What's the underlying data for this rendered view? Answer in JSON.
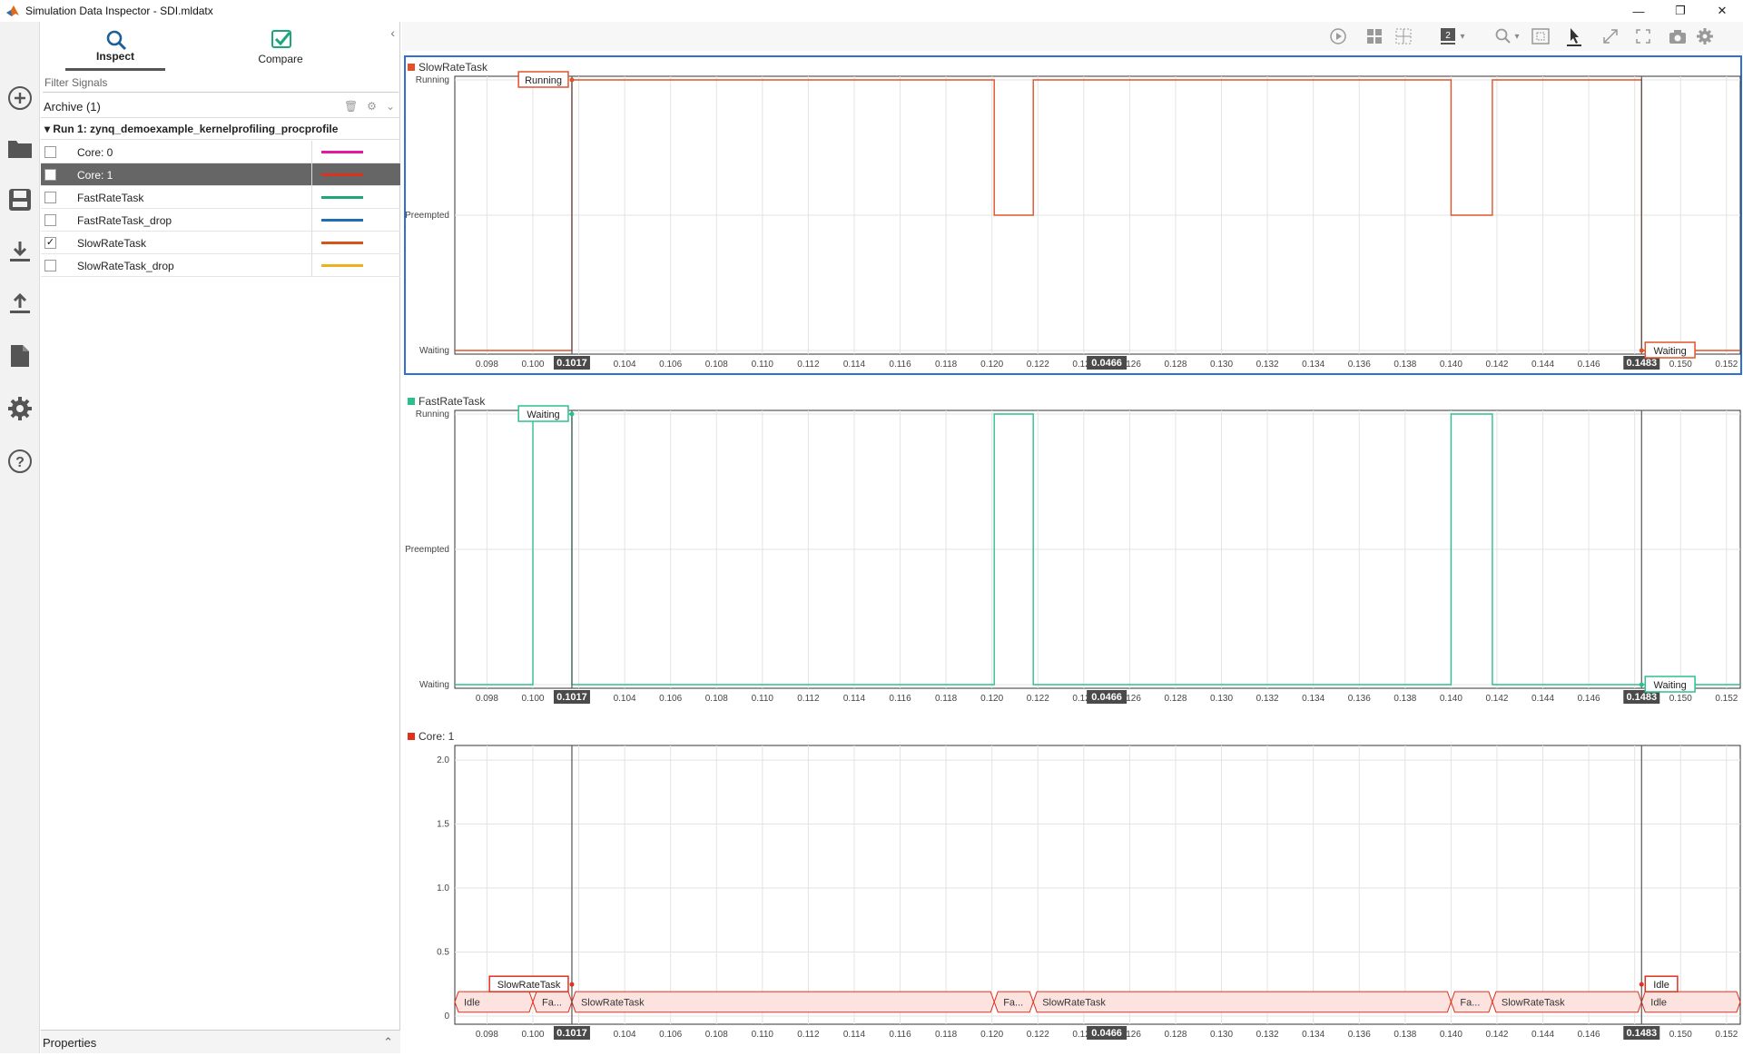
{
  "window": {
    "title": "Simulation Data Inspector - SDI.mldatx",
    "minimize": "—",
    "restore": "❐",
    "close": "✕"
  },
  "tabs": {
    "inspect": "Inspect",
    "compare": "Compare"
  },
  "filter": {
    "placeholder": "Filter Signals"
  },
  "archive": {
    "label": "Archive (1)"
  },
  "run": {
    "label": "Run 1: zynq_demoexample_kernelprofiling_procprofile"
  },
  "signals": [
    {
      "name": "Core: 0",
      "checked": false,
      "selected": false,
      "color": "#e5179f"
    },
    {
      "name": "Core: 1",
      "checked": false,
      "selected": true,
      "color": "#e0301e"
    },
    {
      "name": "FastRateTask",
      "checked": false,
      "selected": false,
      "color": "#1ea67a"
    },
    {
      "name": "FastRateTask_drop",
      "checked": false,
      "selected": false,
      "color": "#1f6eb5"
    },
    {
      "name": "SlowRateTask",
      "checked": true,
      "selected": false,
      "color": "#d95319"
    },
    {
      "name": "SlowRateTask_drop",
      "checked": false,
      "selected": false,
      "color": "#edb120"
    }
  ],
  "properties": {
    "label": "Properties"
  },
  "cursors": {
    "left": "0.1017",
    "right": "0.1483",
    "delta": "0.0466"
  },
  "x_ticks": [
    "0.098",
    "0.100",
    "0.102",
    "0.104",
    "0.106",
    "0.108",
    "0.110",
    "0.112",
    "0.114",
    "0.116",
    "0.118",
    "0.120",
    "0.122",
    "0.124",
    "0.126",
    "0.128",
    "0.130",
    "0.132",
    "0.134",
    "0.136",
    "0.138",
    "0.140",
    "0.142",
    "0.144",
    "0.146",
    "0.148",
    "0.150",
    "0.152"
  ],
  "chart_data": [
    {
      "type": "line",
      "title": "SlowRateTask",
      "color": "#e0522a",
      "y_categories": [
        "Waiting",
        "Preempted",
        "Running"
      ],
      "xlim": [
        0.0966,
        0.1526
      ],
      "x": [
        0.0966,
        0.1017,
        0.1017,
        0.1201,
        0.1201,
        0.1218,
        0.1218,
        0.14,
        0.14,
        0.1418,
        0.1418,
        0.1483,
        0.1483,
        0.1526
      ],
      "y": [
        "Waiting",
        "Waiting",
        "Running",
        "Running",
        "Preempted",
        "Preempted",
        "Running",
        "Running",
        "Preempted",
        "Preempted",
        "Running",
        "Running",
        "Waiting",
        "Waiting"
      ],
      "cursor_labels": {
        "left": "Running",
        "right": "Waiting"
      }
    },
    {
      "type": "line",
      "title": "FastRateTask",
      "color": "#2fbf8f",
      "y_categories": [
        "Waiting",
        "Preempted",
        "Running"
      ],
      "xlim": [
        0.0966,
        0.1526
      ],
      "x": [
        0.0966,
        0.1,
        0.1,
        0.1017,
        0.1017,
        0.1201,
        0.1201,
        0.1218,
        0.1218,
        0.14,
        0.14,
        0.1418,
        0.1418,
        0.1526
      ],
      "y": [
        "Waiting",
        "Waiting",
        "Running",
        "Running",
        "Waiting",
        "Waiting",
        "Running",
        "Running",
        "Waiting",
        "Waiting",
        "Running",
        "Running",
        "Waiting",
        "Waiting"
      ],
      "cursor_labels": {
        "left": "Waiting",
        "right": "Waiting"
      }
    },
    {
      "type": "line",
      "title": "Core: 1",
      "color": "#e0301e",
      "y_ticks": [
        "0",
        "0.5",
        "1.0",
        "1.5",
        "2.0"
      ],
      "ylim": [
        -0.05,
        2.1
      ],
      "xlim": [
        0.0966,
        0.1526
      ],
      "segments": [
        {
          "start": 0.0966,
          "end": 0.1,
          "label": "Idle"
        },
        {
          "start": 0.1,
          "end": 0.1017,
          "label": "Fa..."
        },
        {
          "start": 0.1017,
          "end": 0.1201,
          "label": "SlowRateTask"
        },
        {
          "start": 0.1201,
          "end": 0.1218,
          "label": "Fa..."
        },
        {
          "start": 0.1218,
          "end": 0.14,
          "label": "SlowRateTask"
        },
        {
          "start": 0.14,
          "end": 0.1418,
          "label": "Fa..."
        },
        {
          "start": 0.1418,
          "end": 0.1483,
          "label": "SlowRateTask"
        },
        {
          "start": 0.1483,
          "end": 0.1526,
          "label": "Idle"
        }
      ],
      "cursor_labels": {
        "left": "SlowRateTask",
        "right": "Idle"
      }
    }
  ]
}
